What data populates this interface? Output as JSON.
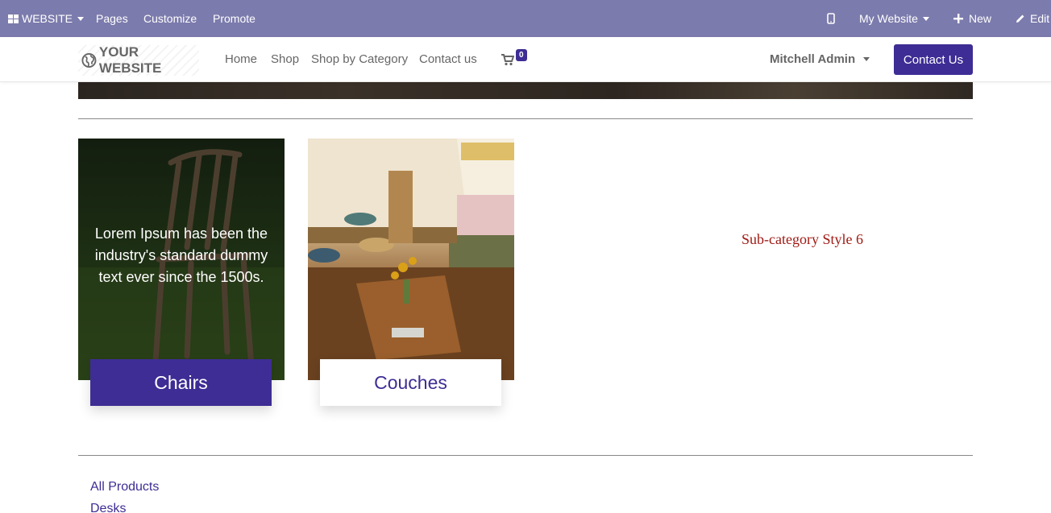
{
  "admin_bar": {
    "website_label": "WEBSITE",
    "pages_label": "Pages",
    "customize_label": "Customize",
    "promote_label": "Promote",
    "my_website_label": "My Website",
    "new_label": "New",
    "edit_label": "Edit"
  },
  "header": {
    "logo_text": "YOUR WEBSITE",
    "nav": [
      "Home",
      "Shop",
      "Shop by Category",
      "Contact us"
    ],
    "cart_count": "0",
    "user_name": "Mitchell Admin",
    "contact_button": "Contact Us"
  },
  "categories": [
    {
      "name": "Chairs",
      "hover_text": "Lorem Ipsum has been the industry's standard dummy text ever since the 1500s."
    },
    {
      "name": "Couches"
    }
  ],
  "subcategory_title": "Sub-category Style 6",
  "product_links": [
    "All Products",
    "Desks"
  ],
  "colors": {
    "admin_bar_bg": "#7c7bad",
    "primary": "#3e2d94",
    "subcategory_text": "#a01a14"
  }
}
